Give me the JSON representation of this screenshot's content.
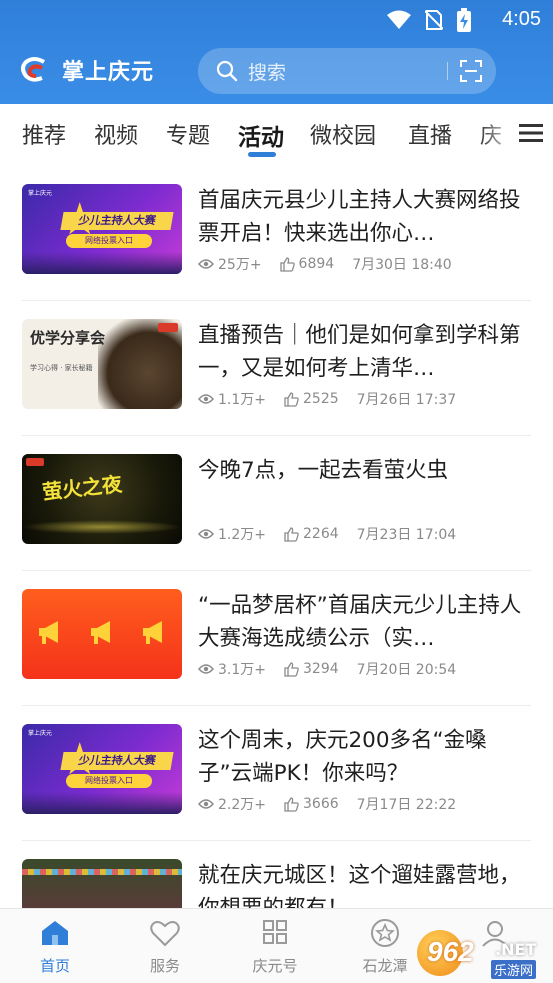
{
  "status_bar": {
    "time": "4:05",
    "icons": [
      "wifi-icon",
      "no-sim-icon",
      "battery-charging-icon"
    ]
  },
  "app_bar": {
    "brand": "掌上庆元",
    "search": {
      "placeholder": "搜索",
      "icon": "search-icon",
      "action_icon": "scan-icon"
    }
  },
  "tabs": {
    "items": [
      {
        "label": "推荐"
      },
      {
        "label": "视频"
      },
      {
        "label": "专题"
      },
      {
        "label": "活动",
        "active": true
      },
      {
        "label": "微校园"
      },
      {
        "label": "直播"
      },
      {
        "label": "庆"
      }
    ],
    "menu_icon": "menu-icon"
  },
  "feed": {
    "items": [
      {
        "title": "首届庆元县少儿主持人大赛网络投票开启！快来选出你心…",
        "views": "25万+",
        "likes": "6894",
        "date": "7月30日 18:40",
        "thumb": {
          "type": "contest",
          "banner": "少儿主持人大赛",
          "button": "网络投票入口"
        }
      },
      {
        "title": "直播预告｜他们是如何拿到学科第一，又是如何考上清华…",
        "views": "1.1万+",
        "likes": "2525",
        "date": "7月26日 17:37",
        "thumb": {
          "type": "share",
          "text": "优学分享会",
          "sub": "学习心得 · 家长秘籍"
        }
      },
      {
        "title": "今晚7点，一起去看萤火虫",
        "views": "1.2万+",
        "likes": "2264",
        "date": "7月23日 17:04",
        "thumb": {
          "type": "night",
          "text": "萤火之夜"
        }
      },
      {
        "title": "“一品梦居杯”首届庆元少儿主持人大赛海选成绩公示（实…",
        "views": "3.1万+",
        "likes": "3294",
        "date": "7月20日 20:54",
        "thumb": {
          "type": "horn"
        }
      },
      {
        "title": "这个周末，庆元200多名“金嗓子”云端PK！你来吗？",
        "views": "2.2万+",
        "likes": "3666",
        "date": "7月17日 22:22",
        "thumb": {
          "type": "contest",
          "banner": "少儿主持人大赛",
          "button": "网络投票入口"
        }
      },
      {
        "title": "就在庆元城区！这个遛娃露营地，你想要的都有！",
        "views": "",
        "likes": "",
        "date": "",
        "thumb": {
          "type": "camp"
        }
      }
    ],
    "colors": {
      "meta": "#8a8a8a",
      "title": "#1f1f1f"
    }
  },
  "bottom_nav": {
    "items": [
      {
        "label": "首页",
        "icon": "home-icon",
        "active": true
      },
      {
        "label": "服务",
        "icon": "heart-icon"
      },
      {
        "label": "庆元号",
        "icon": "grid-icon"
      },
      {
        "label": "石龙潭",
        "icon": "star-icon"
      },
      {
        "label": "我的",
        "icon": "profile-icon"
      }
    ]
  },
  "watermark": {
    "number": "962",
    "suffix": ".NET",
    "site": "乐游网"
  },
  "theme": {
    "primary": "#2f7fd9",
    "header_bg": "#3a8de6"
  }
}
